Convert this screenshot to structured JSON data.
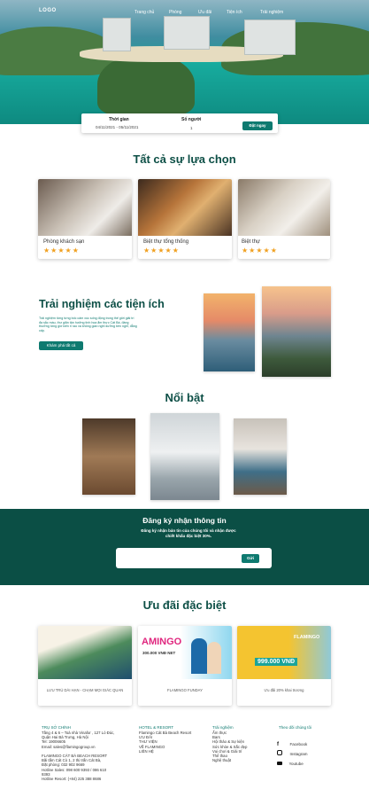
{
  "header": {
    "logo": "LOGO",
    "nav": [
      "Trang chủ",
      "Phòng",
      "Ưu đãi",
      "Tiện ích",
      "Trải nghiệm"
    ]
  },
  "booking": {
    "date_label": "Thời gian",
    "date_value": "04/11/2021 - 05/11/2021",
    "guests_label": "Số người",
    "guests_value": "1",
    "submit_label": "Đặt ngay"
  },
  "choices": {
    "title": "Tất cả sự lựa chọn",
    "items": [
      {
        "title": "Phòng khách sạn",
        "stars": "★★★★★"
      },
      {
        "title": "Biệt thự tổng thống",
        "stars": "★★★★★"
      },
      {
        "title": "Biệt thự",
        "stars": "★★★★★"
      }
    ]
  },
  "amenities": {
    "title": "Trải nghiệm các tiện ích",
    "description": "Trải nghiệm từng từng bốc cảm xúc sống động trong thế giới giải trí đa sắc màu, thư giãn tận hưởng tinh hoa ẩm thực Cát Bà, đáng thưởng từng giờ kiến ri rao và không gian nghỉ dưỡng bên nghỉ, đẳng cấp.",
    "button": "Khám phá tất cả"
  },
  "featured": {
    "title": "Nổi bật"
  },
  "newsletter": {
    "title": "Đăng ký nhận thông tin",
    "subtitle": "Đăng ký nhận bản tin của chúng tôi và nhận được chiết khấu đặc biệt 30%.",
    "input_placeholder": "",
    "button": "Gửi"
  },
  "offers": {
    "title": "Ưu đãi đặc biệt",
    "items": [
      {
        "caption": "LƯU TRÚ DÀI HẠN - CHẠM MỌI GIÁC QUAN"
      },
      {
        "caption": "FLAMINGO FUNDAY",
        "banner": "AMINGO",
        "banner_sub": "300.000 VNĐ NET"
      },
      {
        "caption": "Ưu đãi 20% khai trương",
        "banner": "FLAMINGO",
        "banner_sub": "999.000 VNĐ"
      }
    ]
  },
  "footer": {
    "col1_title": "TRỤ SỞ CHÍNH",
    "col1_text": "Tầng 4 & 6 – Toà nhà Vinafor , 127 Lò Đúc,\nQuận Hai Bà Trưng, Hà Nội\nTel: 19006605\nEmail: sales@flamingogroup.vn\n\nFLAMINGO CÁT BÀ BEACH RESORT\nBãi tắm Cát Cò 1, 2 thị trấn Cát Bà,\nĐặt phòng: 032 902 9669\nHotline Sales: 098 600 9393 / 086 610\n9393\nHotline Resort: (+84) 225 388 8686",
    "col2_title": "HOTEL & RESORT",
    "col2_text": "Flamingo Cát Bà Beach Resort\nƯU ĐÃI\nTHƯ VIỆN\nVỀ FLAMINGO\nLIÊN HỆ",
    "col3_title": "Trải nghiệm",
    "col3_text": "Ẩm thực\nBars\nHội thảo & Sự kiện\nSức khỏe & Sắc đẹp\nVui chơi & Giải trí\nThể thao\nNghệ thuật",
    "col4_title": "Theo dõi chúng tôi",
    "social": [
      "Facebook",
      "Instagram",
      "Youtube"
    ]
  },
  "colors": {
    "accent": "#0e7a70",
    "dark_teal": "#0b4f45",
    "star": "#f0a020"
  }
}
